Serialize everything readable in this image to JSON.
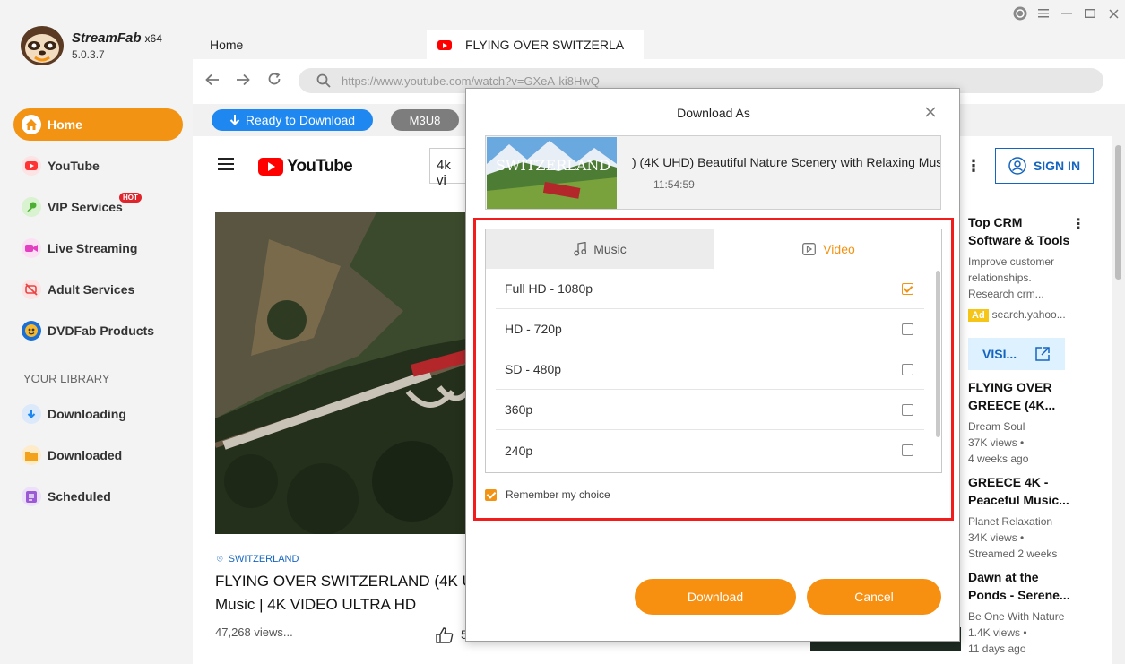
{
  "app": {
    "brand": "StreamFab",
    "arch": "x64",
    "version": "5.0.3.7",
    "accent": "#f39313"
  },
  "window": {
    "controls": [
      "history-icon",
      "menu-icon",
      "maximize-icon",
      "close-icon"
    ]
  },
  "sidebar": {
    "items": [
      {
        "label": "Home",
        "icon": "home-icon",
        "active": true
      },
      {
        "label": "YouTube",
        "icon": "youtube-icon"
      },
      {
        "label": "VIP Services",
        "icon": "key-icon",
        "badge": "HOT"
      },
      {
        "label": "Live Streaming",
        "icon": "camera-icon"
      },
      {
        "label": "Adult Services",
        "icon": "restricted-icon"
      },
      {
        "label": "DVDFab Products",
        "icon": "dvdfab-icon"
      }
    ],
    "library_title": "YOUR LIBRARY",
    "library": [
      {
        "label": "Downloading",
        "icon": "download-icon"
      },
      {
        "label": "Downloaded",
        "icon": "folder-icon"
      },
      {
        "label": "Scheduled",
        "icon": "schedule-icon"
      }
    ]
  },
  "browser": {
    "tabs": [
      {
        "label": "Home"
      },
      {
        "label": "FLYING OVER SWITZERLA"
      }
    ],
    "url": "https://www.youtube.com/watch?v=GXeA-ki8HwQ",
    "ready_label": "Ready to Download",
    "m3u8_label": "M3U8"
  },
  "youtube": {
    "logo": "YouTube",
    "search_value": "4k vi",
    "signin": "SIGN IN",
    "location": "SWITZERLAND",
    "title_line1": "FLYING OVER SWITZERLAND (4K U",
    "title_line2": "Music | 4K VIDEO ULTRA HD",
    "views": "47,268 views...",
    "likes": "5",
    "sidebar": {
      "ad_title_1": "Top CRM",
      "ad_title_2": "Software & Tools",
      "ad_desc_1": "Improve customer",
      "ad_desc_2": "relationships.",
      "ad_desc_3": "Research crm...",
      "ad_badge": "Ad",
      "ad_source": "search.yahoo...",
      "visit": "VISI...",
      "videos": [
        {
          "t1": "FLYING OVER",
          "t2": "GREECE (4K...",
          "ch": "Dream Soul",
          "views": "37K views •",
          "age": "4 weeks ago"
        },
        {
          "t1": "GREECE 4K -",
          "t2": "Peaceful Music...",
          "ch": "Planet Relaxation",
          "views": "34K views •",
          "age": "Streamed 2 weeks"
        },
        {
          "t1": "Dawn at the",
          "t2": "Ponds - Serene...",
          "ch": "Be One With Nature",
          "views": "1.4K views •",
          "age": "11 days ago"
        }
      ]
    }
  },
  "dialog": {
    "title": "Download As",
    "video_title": ") (4K UHD) Beautiful Nature Scenery with Relaxing Mus",
    "duration": "11:54:59",
    "thumb_text": "SWITZERLAND",
    "tab_music": "Music",
    "tab_video": "Video",
    "options": [
      {
        "label": "Full HD - 1080p",
        "checked": true
      },
      {
        "label": "HD - 720p",
        "checked": false
      },
      {
        "label": "SD - 480p",
        "checked": false
      },
      {
        "label": "360p",
        "checked": false
      },
      {
        "label": "240p",
        "checked": false
      }
    ],
    "remember": "Remember my choice",
    "download": "Download",
    "cancel": "Cancel"
  }
}
